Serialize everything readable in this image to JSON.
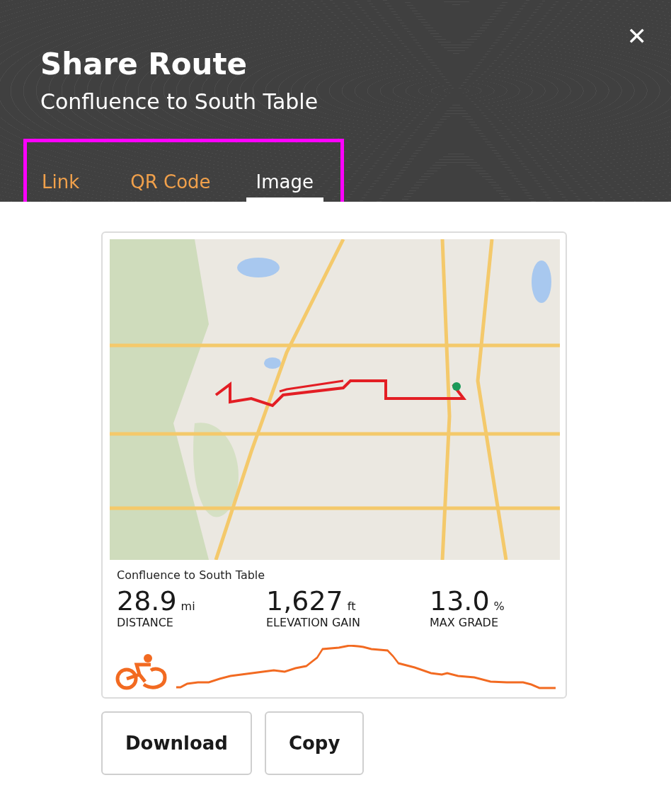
{
  "header": {
    "title": "Share Route",
    "subtitle": "Confluence to South Table",
    "close": "✕"
  },
  "tabs": [
    {
      "label": "Link",
      "selected": false
    },
    {
      "label": "QR Code",
      "selected": false
    },
    {
      "label": "Image",
      "selected": true
    }
  ],
  "card": {
    "route_name": "Confluence to South Table",
    "stats": [
      {
        "value": "28.9",
        "unit": "mi",
        "label": "DISTANCE"
      },
      {
        "value": "1,627",
        "unit": "ft",
        "label": "ELEVATION GAIN"
      },
      {
        "value": "13.0",
        "unit": "%",
        "label": "MAX GRADE"
      }
    ]
  },
  "buttons": [
    "Download",
    "Copy"
  ]
}
